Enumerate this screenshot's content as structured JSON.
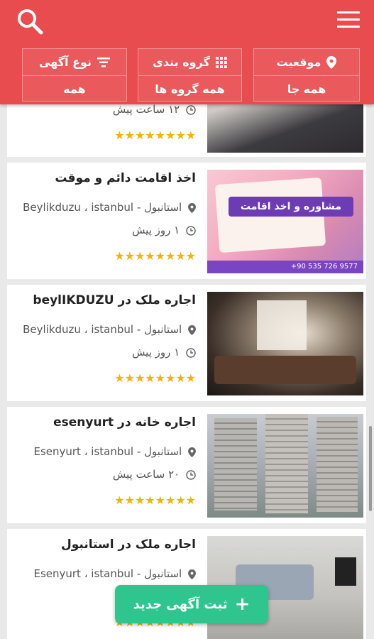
{
  "header": {
    "filters": [
      {
        "label": "موقعیت",
        "value": "همه جا",
        "icon": "location-pin-icon"
      },
      {
        "label": "گروه بندی",
        "value": "همه گروه ها",
        "icon": "grid-icon"
      },
      {
        "label": "نوع آگهی",
        "value": "همه",
        "icon": "filter-lines-icon"
      }
    ]
  },
  "listings": [
    {
      "title": "",
      "location": "",
      "time": "۱۲ ساعت پیش",
      "stars": "★★★★★★★★"
    },
    {
      "title": "اخذ اقامت دائم و موقت",
      "location": "استانبول - Beylikduzu ، istanbul",
      "time": "۱ روز پیش",
      "stars": "★★★★★★★★",
      "image_text": "مشاوره و اخذ اقامت",
      "image_phone": "+90 535 726 9577"
    },
    {
      "title": "اجاره ملک در beylIKDUZU",
      "location": "استانبول - Beylikduzu ، istanbul",
      "time": "۱ روز پیش",
      "stars": "★★★★★★★★"
    },
    {
      "title": "اجاره خانه در esenyurt",
      "location": "استانبول - Esenyurt ، istanbul",
      "time": "۲۰ ساعت پیش",
      "stars": "★★★★★★★★"
    },
    {
      "title": "اجاره ملک در استانبول",
      "location": "استانبول - Esenyurt ، istanbul",
      "time": "",
      "stars": "★★★★★★★★"
    }
  ],
  "fab": {
    "label": "ثبت آگهی جدید",
    "icon": "plus-icon"
  }
}
